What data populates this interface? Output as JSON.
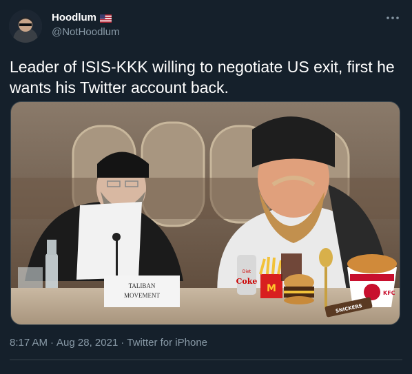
{
  "tweet": {
    "author_name": "Hoodlum",
    "author_handle": "@NotHoodlum",
    "author_flag": "us-flag-icon",
    "text": "Leader of ISIS-KKK willing to negotiate US exit, first he wants his Twitter account back.",
    "time": "8:17 AM",
    "date": "Aug 28, 2021",
    "source": "Twitter for iPhone",
    "separator": "·",
    "more_icon": "more-dots-icon"
  },
  "media": {
    "placard_line1": "TALIBAN",
    "placard_line2": "MOVEMENT",
    "can_label": "Coke",
    "can_sublabel": "Diet",
    "bucket_label": "KFC",
    "bar_label": "SNICKERS"
  },
  "colors": {
    "background": "#15202b",
    "text_primary": "#ffffff",
    "text_secondary": "#8899a6",
    "border": "#38444d"
  }
}
